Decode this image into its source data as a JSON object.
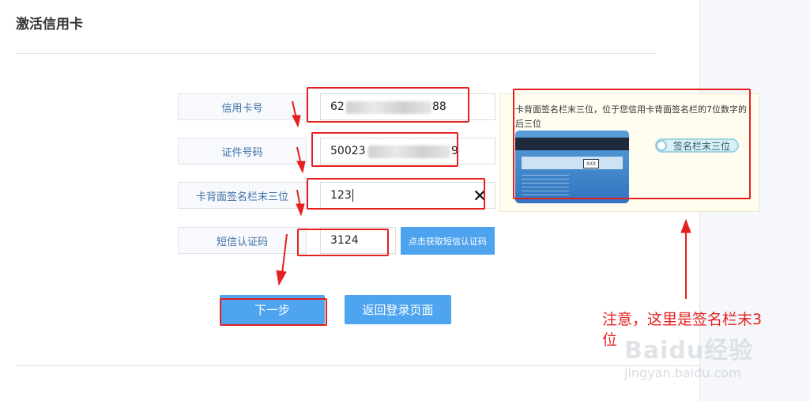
{
  "page": {
    "title": "激活信用卡"
  },
  "form": {
    "card_number": {
      "label": "信用卡号",
      "value_prefix": "62",
      "value_suffix": "88"
    },
    "id_number": {
      "label": "证件号码",
      "value_prefix": "50023",
      "value_suffix": "9"
    },
    "cvv": {
      "label": "卡背面签名栏末三位",
      "value": "123"
    },
    "sms_code": {
      "label": "短信认证码",
      "value": "3124"
    },
    "get_sms_button": "点击获取短信认证码",
    "next_button": "下一步",
    "back_button": "返回登录页面"
  },
  "tip": {
    "text": "卡背面签名栏末三位，位于您信用卡背面签名栏的7位数字的后三位",
    "card_code": "XXX",
    "signature_label": "签名栏末三位"
  },
  "annotation": {
    "note": "注意，这里是签名栏末3位",
    "color": "#e5201f"
  },
  "watermark": {
    "brand": "Baidu经验",
    "url": "jingyan.baidu.com"
  }
}
